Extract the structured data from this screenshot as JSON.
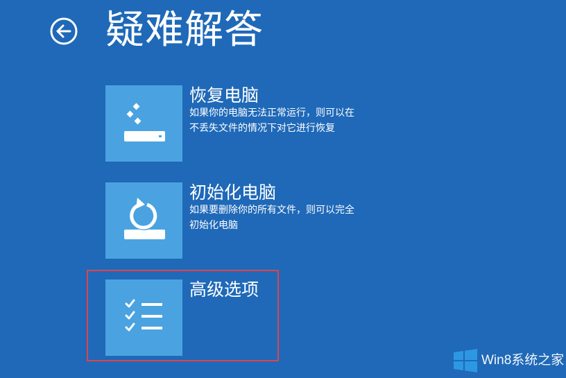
{
  "page": {
    "title": "疑难解答",
    "back_icon": "back-arrow-icon",
    "background": "#1f69b8"
  },
  "options": [
    {
      "title": "恢复电脑",
      "description": "如果你的电脑无法正常运行，则可以在不丢失文件的情况下对它进行恢复",
      "icon": "refresh-pc-icon"
    },
    {
      "title": "初始化电脑",
      "description": "如果要删除你的所有文件，则可以完全初始化电脑",
      "icon": "reset-pc-icon"
    },
    {
      "title": "高级选项",
      "description": "",
      "icon": "checklist-icon"
    }
  ],
  "colors": {
    "tile": "#4aa3e0",
    "highlight": "#e0434d"
  },
  "watermark": {
    "text": "Win8系统之家",
    "icon": "windows-logo-icon"
  }
}
